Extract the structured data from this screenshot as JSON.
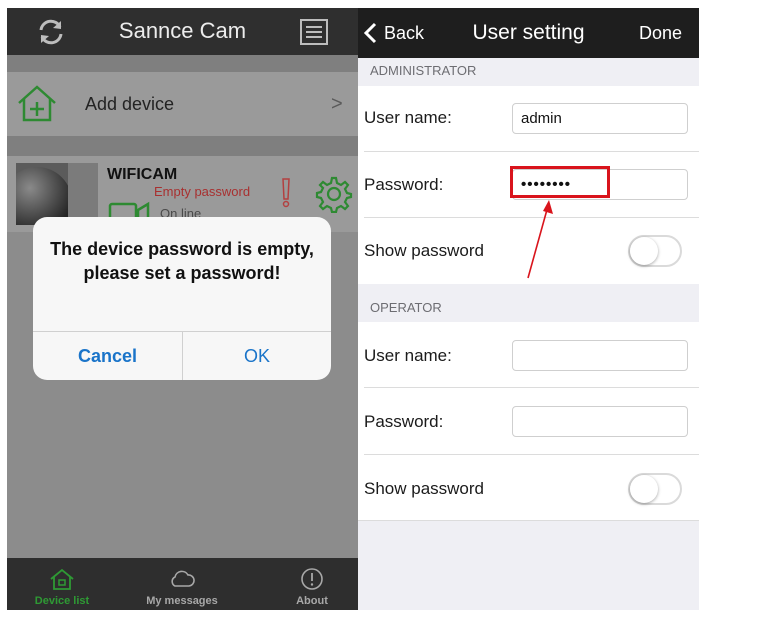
{
  "left_screen": {
    "header": {
      "title": "Sannce Cam",
      "refresh_icon": "refresh-icon",
      "menu_icon": "list-icon"
    },
    "add_device": {
      "label": "Add device",
      "chevron": ">"
    },
    "device": {
      "name": "WIFICAM",
      "warning": "Empty password",
      "status": "On line"
    },
    "dialog": {
      "message": "The device password is empty, please set a password!",
      "cancel": "Cancel",
      "ok": "OK"
    },
    "tabs": [
      {
        "label": "Device list",
        "icon": "home-icon",
        "active": true
      },
      {
        "label": "My messages",
        "icon": "cloud-icon",
        "active": false
      },
      {
        "label": "About",
        "icon": "info-icon",
        "active": false
      }
    ],
    "colors": {
      "active_tab": "#2e9a34",
      "dialog_button": "#1a74c9",
      "warning": "#a83030"
    }
  },
  "right_screen": {
    "header": {
      "back": "Back",
      "title": "User setting",
      "done": "Done"
    },
    "administrator": {
      "section": "ADMINISTRATOR",
      "username_label": "User name:",
      "username_value": "admin",
      "password_label": "Password:",
      "password_value": "••••••••",
      "show_password_label": "Show password",
      "show_password_on": false
    },
    "operator": {
      "section": "OPERATOR",
      "username_label": "User name:",
      "username_value": "",
      "password_label": "Password:",
      "password_value": "",
      "show_password_label": "Show password",
      "show_password_on": false
    },
    "annotation_color": "#d9141c"
  }
}
